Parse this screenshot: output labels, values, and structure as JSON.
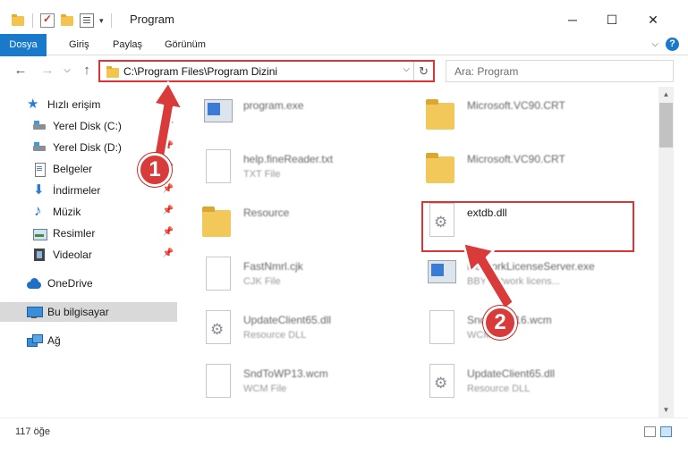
{
  "window": {
    "title": "Program",
    "minimize": "─",
    "maximize": "☐",
    "close": "✕"
  },
  "ribbon": {
    "tabs": [
      {
        "label": "Dosya"
      },
      {
        "label": "Giriş"
      },
      {
        "label": "Paylaş"
      },
      {
        "label": "Görünüm"
      }
    ],
    "help": "?",
    "collapse": "⌵"
  },
  "address": {
    "path": "C:\\Program Files\\Program Dizini",
    "dropdown": "⌵",
    "refresh": "↻"
  },
  "search": {
    "placeholder": "Ara: Program"
  },
  "nav": {
    "back": "←",
    "forward": "→",
    "recent": "⌵",
    "up": "↑",
    "items": [
      {
        "label": "Hızlı erişim",
        "icon": "star-icon"
      },
      {
        "label": "Yerel Disk (C:)",
        "icon": "disk-icon"
      },
      {
        "label": "Yerel Disk (D:)",
        "icon": "disk-icon"
      },
      {
        "label": "Belgeler",
        "icon": "document-icon"
      },
      {
        "label": "İndirmeler",
        "icon": "download-icon"
      },
      {
        "label": "Müzik",
        "icon": "music-icon"
      },
      {
        "label": "Resimler",
        "icon": "picture-icon"
      },
      {
        "label": "Videolar",
        "icon": "video-icon"
      },
      {
        "label": "OneDrive",
        "icon": "cloud-icon"
      },
      {
        "label": "Bu bilgisayar",
        "icon": "computer-icon"
      },
      {
        "label": "Ağ",
        "icon": "network-icon"
      }
    ]
  },
  "files": [
    {
      "name": "program.exe",
      "type": ""
    },
    {
      "name": "Microsoft.VC90.CRT",
      "type": ""
    },
    {
      "name": "help.fineReader.txt",
      "type": "TXT File"
    },
    {
      "name": "Microsoft.VC90.CRT",
      "type": ""
    },
    {
      "name": "Resource",
      "type": ""
    },
    {
      "name": "extdb.dll",
      "type": ""
    },
    {
      "name": "FastNmrl.cjk",
      "type": "CJK File"
    },
    {
      "name": "NetworkLicenseServer.exe",
      "type": "BBY network licens..."
    },
    {
      "name": "UpdateClient65.dll",
      "type": "Resource DLL"
    },
    {
      "name": "SndToWP16.wcm",
      "type": "WCM File"
    },
    {
      "name": "SndToWP13.wcm",
      "type": "WCM File"
    },
    {
      "name": "UpdateClient65.dll",
      "type": "Resource DLL"
    }
  ],
  "status": {
    "count": "117 öğe"
  },
  "annotations": {
    "step1": "1",
    "step2": "2",
    "color": "#d93a3a"
  }
}
